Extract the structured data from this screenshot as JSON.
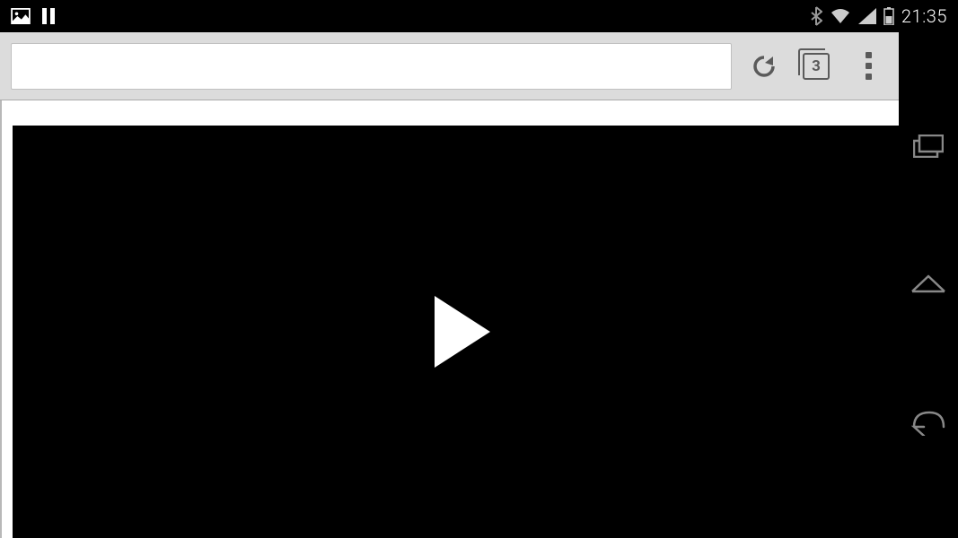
{
  "status_bar": {
    "time": "21:35",
    "icons": {
      "gallery": "gallery-icon",
      "pause": "pause-icon",
      "bluetooth": "bluetooth-icon",
      "wifi": "wifi-icon",
      "signal": "signal-icon",
      "battery": "battery-icon"
    }
  },
  "browser": {
    "url": "",
    "tab_count": "3"
  },
  "nav": {
    "recent": "recent-apps",
    "home": "home",
    "back": "back"
  }
}
